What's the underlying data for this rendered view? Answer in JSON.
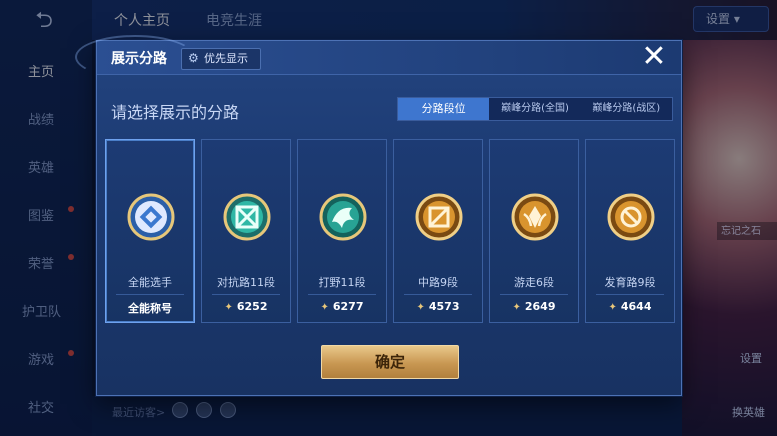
{
  "background": {
    "sidebar": {
      "items": [
        {
          "label": "主页",
          "active": true
        },
        {
          "label": "战绩"
        },
        {
          "label": "英雄"
        },
        {
          "label": "图鉴"
        },
        {
          "label": "荣誉"
        },
        {
          "label": "护卫队"
        },
        {
          "label": "游戏"
        },
        {
          "label": "社交"
        }
      ]
    },
    "top_tabs": [
      "个人主页",
      "电竞生涯"
    ],
    "settings_label": "设置",
    "art_label": "忘记之石",
    "recent_visitors": "最近访客>",
    "right_buttons": [
      "设置",
      "换英雄"
    ]
  },
  "modal": {
    "title": "展示分路",
    "priority_label": "优先显示",
    "prompt": "请选择展示的分路",
    "tabs": [
      {
        "label": "分路段位",
        "active": true
      },
      {
        "label": "巅峰分路(全国)"
      },
      {
        "label": "巅峰分路(战区)"
      }
    ],
    "cards": [
      {
        "label": "全能选手",
        "score": "全能称号",
        "badge": "all-round",
        "selected": true
      },
      {
        "label": "对抗路11段",
        "score": "6252",
        "badge": "clash-lane"
      },
      {
        "label": "打野11段",
        "score": "6277",
        "badge": "jungle"
      },
      {
        "label": "中路9段",
        "score": "4573",
        "badge": "mid-lane"
      },
      {
        "label": "游走6段",
        "score": "2649",
        "badge": "roam"
      },
      {
        "label": "发育路9段",
        "score": "4644",
        "badge": "farm-lane"
      }
    ],
    "confirm_label": "确定"
  },
  "colors": {
    "accent_blue": "#3e76cf",
    "gold": "#d4a85c",
    "modal_bg": "#1c3a72"
  }
}
